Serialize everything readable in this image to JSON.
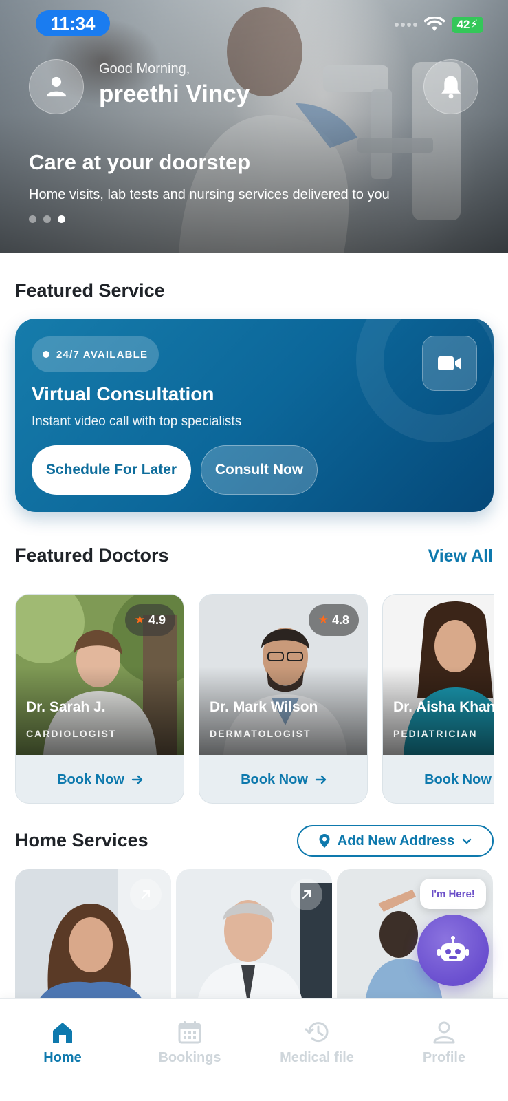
{
  "status_bar": {
    "time": "11:34",
    "battery": "42"
  },
  "header": {
    "greeting": "Good Morning,",
    "username": "preethi Vincy",
    "avatar_icon": "user-icon",
    "bell_icon": "bell-icon"
  },
  "hero": {
    "title": "Care at your doorstep",
    "subtitle": "Home visits, lab tests and nursing services delivered to you",
    "slide_count": 3,
    "active_slide": 3
  },
  "featured_service": {
    "section_title": "Featured Service",
    "badge": "24/7 AVAILABLE",
    "title": "Virtual Consultation",
    "subtitle": "Instant video call with top specialists",
    "schedule_label": "Schedule For Later",
    "consult_label": "Consult Now",
    "icon": "video-camera-icon"
  },
  "featured_doctors": {
    "section_title": "Featured Doctors",
    "view_all": "View All",
    "doctors": [
      {
        "name": "Dr. Sarah J.",
        "specialty": "CARDIOLOGIST",
        "rating": "4.9",
        "book_label": "Book Now"
      },
      {
        "name": "Dr. Mark Wilson",
        "specialty": "DERMATOLOGIST",
        "rating": "4.8",
        "book_label": "Book Now"
      },
      {
        "name": "Dr. Aisha Khan",
        "specialty": "PEDIATRICIAN",
        "rating": "",
        "book_label": "Book Now"
      }
    ]
  },
  "home_services": {
    "section_title": "Home Services",
    "address_button": "Add New Address"
  },
  "assistant": {
    "bubble": "I'm Here!"
  },
  "bottom_nav": {
    "items": [
      {
        "label": "Home",
        "icon": "home-icon",
        "active": true
      },
      {
        "label": "Bookings",
        "icon": "calendar-icon",
        "active": false
      },
      {
        "label": "Medical file",
        "icon": "history-icon",
        "active": false
      },
      {
        "label": "Profile",
        "icon": "profile-icon",
        "active": false
      }
    ]
  },
  "colors": {
    "primary": "#0e79ad",
    "card_gradient_start": "#167cab",
    "card_gradient_end": "#054878",
    "assistant": "#6a4fcf",
    "rating_star": "#ff6a1a"
  }
}
